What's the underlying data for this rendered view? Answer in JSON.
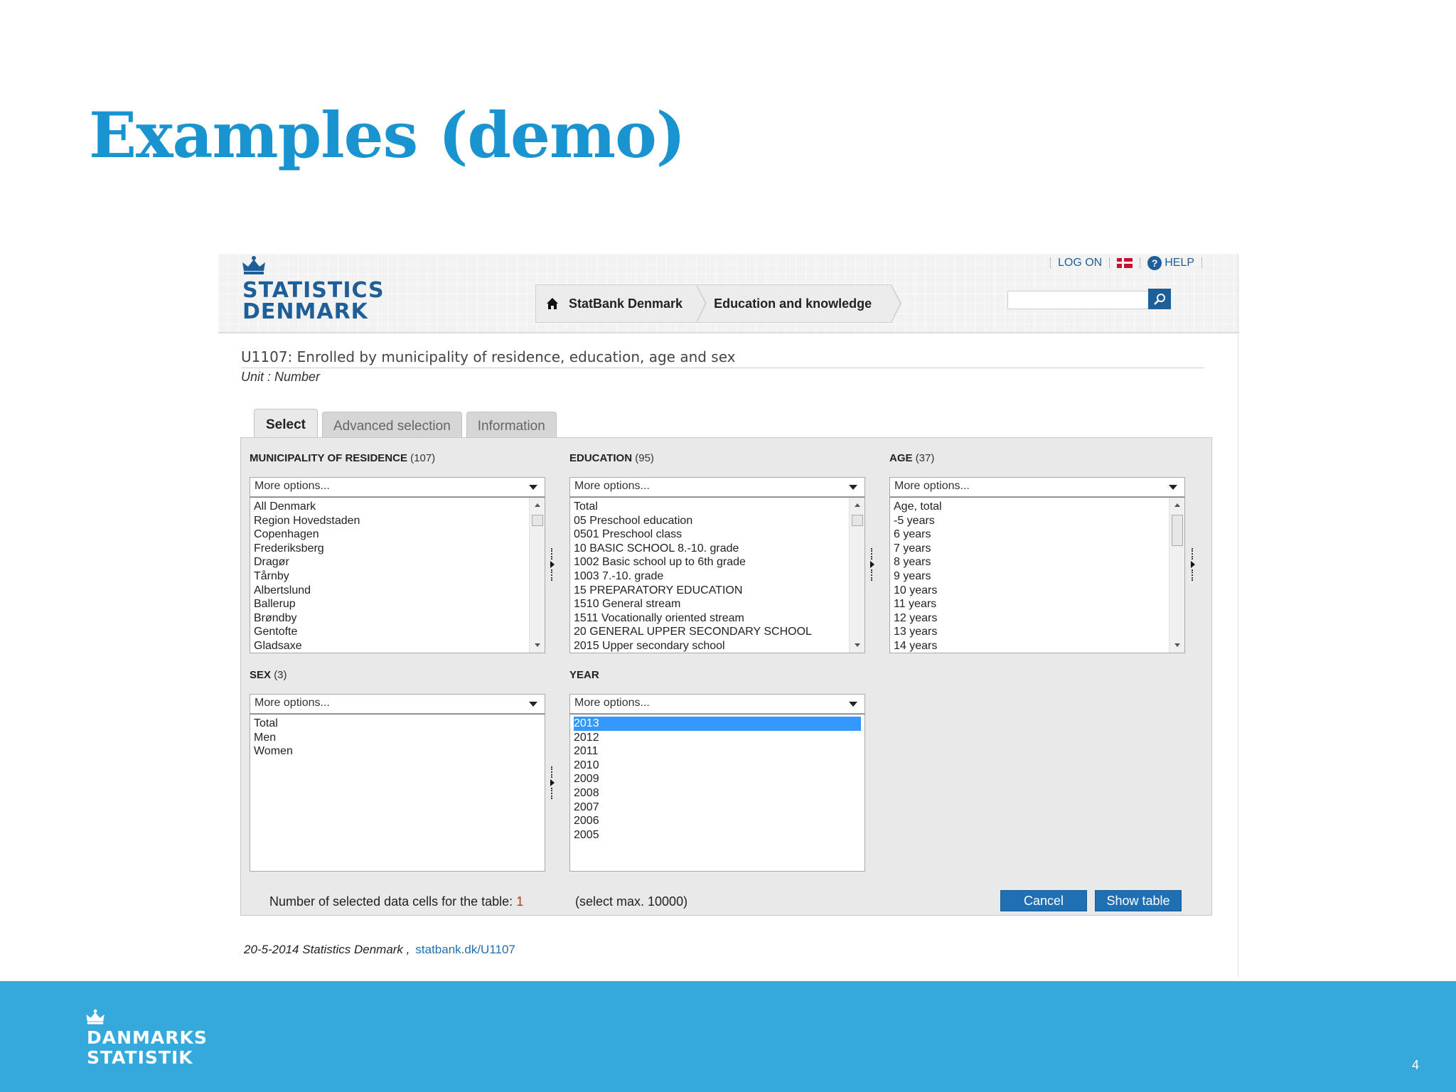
{
  "slide": {
    "title": "Examples (demo)",
    "page_number": "4",
    "footer_logo": [
      "DANMARKS",
      "STATISTIK"
    ]
  },
  "site": {
    "logo": [
      "STATISTICS",
      "DENMARK"
    ],
    "top_links": {
      "logon": "LOG ON",
      "help": "HELP"
    },
    "breadcrumb": [
      "StatBank Denmark",
      "Education and knowledge"
    ],
    "search": {
      "value": ""
    }
  },
  "table": {
    "title": "U1107: Enrolled by municipality of residence, education, age and sex",
    "unit": "Unit : Number"
  },
  "tabs": [
    "Select",
    "Advanced selection",
    "Information"
  ],
  "variables": {
    "municipality": {
      "label": "MUNICIPALITY OF RESIDENCE",
      "count": "(107)",
      "more": "More options...",
      "items": [
        "All Denmark",
        "Region Hovedstaden",
        "Copenhagen",
        "Frederiksberg",
        "Dragør",
        "Tårnby",
        "Albertslund",
        "Ballerup",
        "Brøndby",
        "Gentofte",
        "Gladsaxe"
      ]
    },
    "education": {
      "label": "EDUCATION",
      "count": "(95)",
      "more": "More options...",
      "items": [
        "Total",
        "05 Preschool education",
        "0501 Preschool class",
        "10 BASIC SCHOOL 8.-10. grade",
        "1002 Basic school up to 6th grade",
        "1003 7.-10. grade",
        "15 PREPARATORY EDUCATION",
        "1510 General stream",
        "1511 Vocationally oriented stream",
        "20 GENERAL UPPER SECONDARY SCHOOL",
        "2015 Upper secondary school"
      ]
    },
    "age": {
      "label": "AGE",
      "count": "(37)",
      "more": "More options...",
      "items": [
        "Age, total",
        "-5 years",
        "6 years",
        "7 years",
        "8 years",
        "9 years",
        "10 years",
        "11 years",
        "12 years",
        "13 years",
        "14 years"
      ]
    },
    "sex": {
      "label": "SEX",
      "count": "(3)",
      "more": "More options...",
      "items": [
        "Total",
        "Men",
        "Women"
      ]
    },
    "year": {
      "label": "YEAR",
      "more": "More options...",
      "items": [
        "2013",
        "2012",
        "2011",
        "2010",
        "2009",
        "2008",
        "2007",
        "2006",
        "2005"
      ],
      "selected": "2013"
    }
  },
  "status": {
    "cells_label": "Number of selected data cells for the table:",
    "cells_value": "1",
    "max": "(select max. 10000)"
  },
  "buttons": {
    "cancel": "Cancel",
    "show": "Show table"
  },
  "source": {
    "text": "20-5-2014 Statistics Denmark ,",
    "link": "statbank.dk/U1107"
  },
  "colors": {
    "title_blue": "#1a94d1",
    "footer_blue": "#35a8dc",
    "button_blue": "#1f6fb2",
    "logo_blue": "#1f5f99",
    "selection": "#3399ff"
  }
}
